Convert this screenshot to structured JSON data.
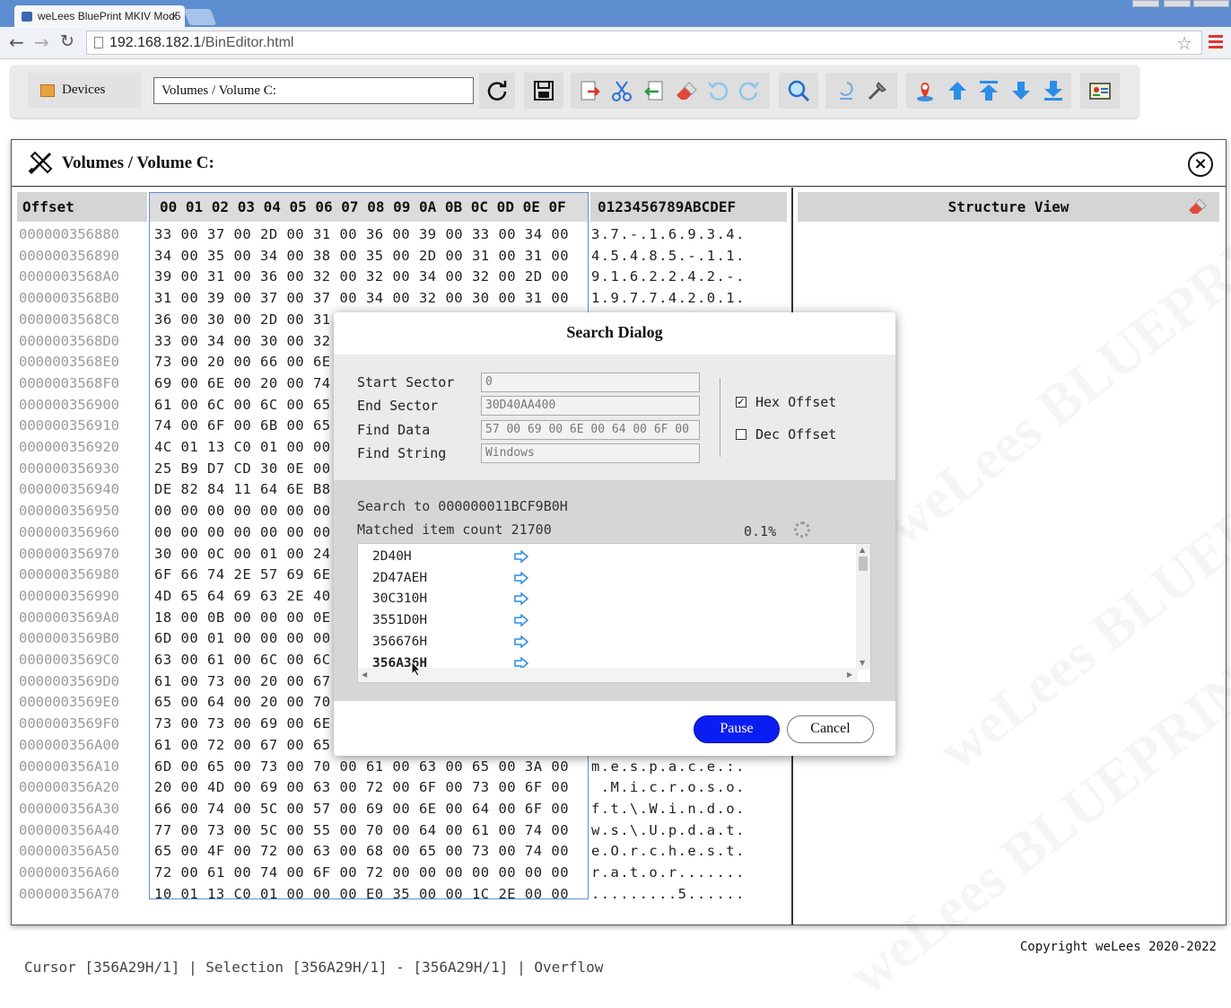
{
  "browser": {
    "tab_title": "weLees BluePrint MKIV Mod5",
    "url_host": "192.168.182.1",
    "url_path": "/BinEditor.html"
  },
  "toolbar": {
    "devices_label": "Devices",
    "path_value": "Volumes / Volume C:",
    "icons": [
      "refresh-icon",
      "save-icon",
      "export-icon",
      "cut-icon",
      "import-icon",
      "erase-icon",
      "undo-icon",
      "redo-icon",
      "search-icon",
      "inspect-icon",
      "tools-icon",
      "locate-icon",
      "up-icon",
      "top-icon",
      "down-icon",
      "bottom-icon",
      "id-card-icon"
    ]
  },
  "panel": {
    "title": "Volumes / Volume C:",
    "offset_header": "Offset",
    "hex_header": "00 01 02 03 04 05 06 07 08 09 0A 0B 0C 0D 0E 0F",
    "ascii_header": "0123456789ABCDEF",
    "structure_header": "Structure View",
    "rows": [
      {
        "off": "000000356880",
        "hex": "33 00 37 00 2D 00 31 00 36 00 39 00 33 00 34 00",
        "asc": "3.7.-.1.6.9.3.4."
      },
      {
        "off": "000000356890",
        "hex": "34 00 35 00 34 00 38 00 35 00 2D 00 31 00 31 00",
        "asc": "4.5.4.8.5.-.1.1."
      },
      {
        "off": "0000003568A0",
        "hex": "39 00 31 00 36 00 32 00 32 00 34 00 32 00 2D 00",
        "asc": "9.1.6.2.2.4.2.-."
      },
      {
        "off": "0000003568B0",
        "hex": "31 00 39 00 37 00 37 00 34 00 32 00 30 00 31 00",
        "asc": "1.9.7.7.4.2.0.1."
      },
      {
        "off": "0000003568C0",
        "hex": "36 00 30 00 2D 00 31",
        "asc": ""
      },
      {
        "off": "0000003568D0",
        "hex": "33 00 34 00 30 00 32",
        "asc": ""
      },
      {
        "off": "0000003568E0",
        "hex": "73 00 20 00 66 00 6E",
        "asc": ""
      },
      {
        "off": "0000003568F0",
        "hex": "69 00 6E 00 20 00 74",
        "asc": ""
      },
      {
        "off": "000000356900",
        "hex": "61 00 6C 00 6C 00 65",
        "asc": ""
      },
      {
        "off": "000000356910",
        "hex": "74 00 6F 00 6B 00 65",
        "asc": ""
      },
      {
        "off": "000000356920",
        "hex": "4C 01 13 C0 01 00 00",
        "asc": ""
      },
      {
        "off": "000000356930",
        "hex": "25 B9 D7 CD 30 0E 00",
        "asc": ""
      },
      {
        "off": "000000356940",
        "hex": "DE 82 84 11 64 6E B8",
        "asc": ""
      },
      {
        "off": "000000356950",
        "hex": "00 00 00 00 00 00 00",
        "asc": ""
      },
      {
        "off": "000000356960",
        "hex": "00 00 00 00 00 00 00",
        "asc": ""
      },
      {
        "off": "000000356970",
        "hex": "30 00 0C 00 01 00 24",
        "asc": ""
      },
      {
        "off": "000000356980",
        "hex": "6F 66 74 2E 57 69 6E",
        "asc": ""
      },
      {
        "off": "000000356990",
        "hex": "4D 65 64 69 63 2E 40",
        "asc": ""
      },
      {
        "off": "0000003569A0",
        "hex": "18 00 0B 00 00 00 0E",
        "asc": ""
      },
      {
        "off": "0000003569B0",
        "hex": "6D 00 01 00 00 00 00",
        "asc": ""
      },
      {
        "off": "0000003569C0",
        "hex": "63 00 61 00 6C 00 6C",
        "asc": ""
      },
      {
        "off": "0000003569D0",
        "hex": "61 00 73 00 20 00 67",
        "asc": ""
      },
      {
        "off": "0000003569E0",
        "hex": "65 00 64 00 20 00 70",
        "asc": ""
      },
      {
        "off": "0000003569F0",
        "hex": "73 00 73 00 69 00 6E",
        "asc": ""
      },
      {
        "off": "000000356A00",
        "hex": "61 00 72 00 67 00 65",
        "asc": ""
      },
      {
        "off": "000000356A10",
        "hex": "6D 00 65 00 73 00 70 00 61 00 63 00 65 00 3A 00",
        "asc": "m.e.s.p.a.c.e.:."
      },
      {
        "off": "000000356A20",
        "hex": "20 00 4D 00 69 00 63 00 72 00 6F 00 73 00 6F 00",
        "asc": " .M.i.c.r.o.s.o."
      },
      {
        "off": "000000356A30",
        "hex": "66 00 74 00 5C 00 57 00 69 00 6E 00 64 00 6F 00",
        "asc": "f.t.\\.W.i.n.d.o."
      },
      {
        "off": "000000356A40",
        "hex": "77 00 73 00 5C 00 55 00 70 00 64 00 61 00 74 00",
        "asc": "w.s.\\.U.p.d.a.t."
      },
      {
        "off": "000000356A50",
        "hex": "65 00 4F 00 72 00 63 00 68 00 65 00 73 00 74 00",
        "asc": "e.O.r.c.h.e.s.t."
      },
      {
        "off": "000000356A60",
        "hex": "72 00 61 00 74 00 6F 00 72 00 00 00 00 00 00 00",
        "asc": "r.a.t.o.r......."
      },
      {
        "off": "000000356A70",
        "hex": "10 01 13 C0 01 00 00 00 E0 35 00 00 1C 2E 00 00",
        "asc": ".........5......"
      }
    ],
    "status": "Cursor [356A29H/1] | Selection [356A29H/1] - [356A29H/1] | Overflow",
    "watermark": "weLees BLUEPRINT"
  },
  "dialog": {
    "title": "Search Dialog",
    "start_sector_label": "Start Sector",
    "start_sector_value": "0",
    "end_sector_label": "End Sector",
    "end_sector_value": "30D40AA400",
    "find_data_label": "Find Data",
    "find_data_value": "57 00 69 00 6E 00 64 00 6F 00",
    "find_string_label": "Find String",
    "find_string_value": "Windows",
    "hex_offset_label": "Hex Offset",
    "hex_offset_checked": true,
    "dec_offset_label": "Dec Offset",
    "dec_offset_checked": false,
    "search_to": "Search to 000000011BCF9B0H",
    "matched": "Matched item count 21700",
    "percent": "0.1%",
    "results": [
      "2D40H",
      "2D47AEH",
      "30C310H",
      "3551D0H",
      "356676H",
      "356A36H"
    ],
    "pause_label": "Pause",
    "cancel_label": "Cancel"
  },
  "footer": "Copyright weLees 2020-2022"
}
